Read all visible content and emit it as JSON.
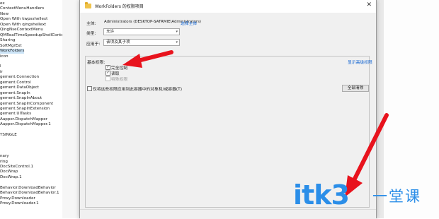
{
  "tree": {
    "items": [
      {
        "label": "ex"
      },
      {
        "label": "ContextMenuHandlers"
      },
      {
        "label": "New"
      },
      {
        "label": "Open With kwpsshellext"
      },
      {
        "label": "Open With qingshellext"
      },
      {
        "label": "QingNseContextMenu"
      },
      {
        "label": "QMRealTimeSpeedupShellContextMe"
      },
      {
        "label": "Sharing"
      },
      {
        "label": "SoftMgrExt"
      },
      {
        "label": "WorkFolders",
        "selected": true
      },
      {
        "label": "icon"
      },
      {
        "label": ""
      },
      {
        "label": "l"
      },
      {
        "label": "ir"
      },
      {
        "label": "gement.Connection"
      },
      {
        "label": "gement.Control"
      },
      {
        "label": "gement.DataObject"
      },
      {
        "label": "gement.SnapIn"
      },
      {
        "label": "gement.SnapInAbout"
      },
      {
        "label": "gement.SnapInComponent"
      },
      {
        "label": "gement.SnapInExtension"
      },
      {
        "label": "gement.UITasks"
      },
      {
        "label": "Aapper.DispatchMapper"
      },
      {
        "label": "Aapper.DispatchMapper.1"
      },
      {
        "label": ""
      },
      {
        "label": "YSINGLE"
      },
      {
        "label": ""
      },
      {
        "label": ""
      },
      {
        "label": ""
      },
      {
        "label": "nary"
      },
      {
        "label": "ring"
      },
      {
        "label": "DocSiteControl.1"
      },
      {
        "label": "DocWrap"
      },
      {
        "label": "DocWrap.1"
      },
      {
        "label": ""
      },
      {
        "label": "Behavior.DownloadBehavior"
      },
      {
        "label": "Behavior.DownloadBehavior.1"
      },
      {
        "label": "Proxy.Downloader"
      },
      {
        "label": "Proxy.Downloader.1"
      }
    ]
  },
  "dialog": {
    "title": "WorkFolders 的权限项目",
    "close_glyph": "✕",
    "principal_label": "主体:",
    "principal_value": "Administrators (DESKTOP-SATRMIE\\Administrators)",
    "select_principal_link": "选择主体",
    "type_label": "类型:",
    "type_value": "允许",
    "applies_label": "应用于:",
    "applies_value": "该项及其子项",
    "basic_perms_label": "基本权限:",
    "advanced_link": "显示高级权限",
    "perms": [
      {
        "label": "完全控制",
        "checked": true,
        "enabled": true
      },
      {
        "label": "读取",
        "checked": true,
        "enabled": true
      },
      {
        "label": "特殊权限",
        "checked": false,
        "enabled": false
      }
    ],
    "apply_inside_label": "仅将这些权限应用到此容器中的对象和/或容器(T)",
    "clear_all_button": "全部清除",
    "check_glyph": "✓"
  },
  "colors": {
    "arrow": "#e8131d",
    "watermark": "#2b8ee8",
    "link": "#0a5fd0"
  },
  "watermark": {
    "brand": "itk3",
    "tagline": "一堂课"
  }
}
